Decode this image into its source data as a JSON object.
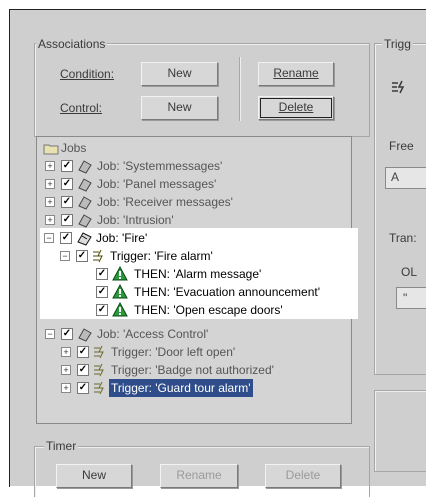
{
  "associations": {
    "legend": "Associations",
    "condition_label": "Condition:",
    "control_label": "Control:",
    "new_label": "New",
    "rename_label": "Rename",
    "delete_label": "Delete"
  },
  "tree": {
    "root": "Jobs",
    "jobs_top": [
      "Job: 'Systemmessages'",
      "Job: 'Panel messages'",
      "Job: 'Receiver messages'",
      "Job: 'Intrusion'"
    ],
    "job_fire": "Job: 'Fire'",
    "trigger_fire": "Trigger: 'Fire alarm'",
    "then_items": [
      "THEN: 'Alarm message'",
      "THEN: 'Evacuation announcement'",
      "THEN: 'Open escape doors'"
    ],
    "job_access": "Job: 'Access Control'",
    "access_triggers": [
      "Trigger: 'Door left open'",
      "Trigger: 'Badge not authorized'"
    ],
    "selected_trigger": "Trigger: 'Guard tour alarm'"
  },
  "timer": {
    "legend": "Timer",
    "new_label": "New",
    "rename_label": "Rename",
    "delete_label": "Delete"
  },
  "right_panel": {
    "legend": "Trigg",
    "free_label": "Free",
    "field_a": "A",
    "trans_label": "Tran:",
    "ol_label": "OL",
    "field_b": "\""
  }
}
